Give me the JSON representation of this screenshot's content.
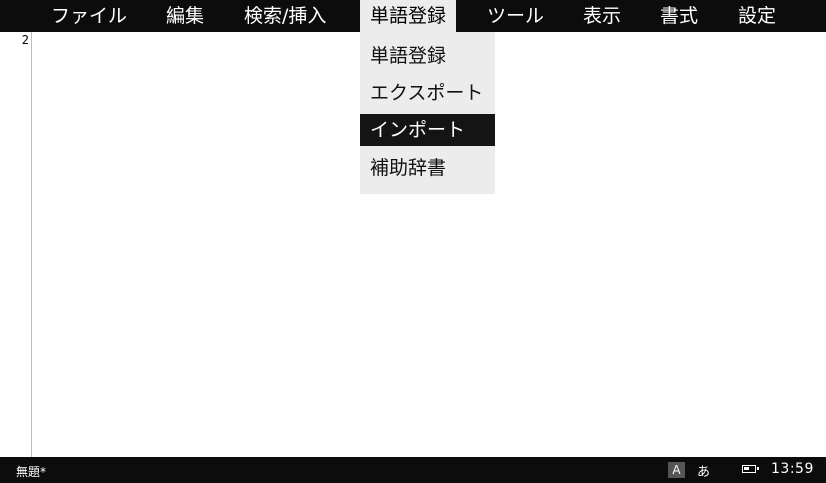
{
  "menubar": {
    "items": [
      {
        "label": "ファイル"
      },
      {
        "label": "編集"
      },
      {
        "label": "検索/挿入"
      },
      {
        "label": "単語登録",
        "active": true
      },
      {
        "label": "ツール"
      },
      {
        "label": "表示"
      },
      {
        "label": "書式"
      },
      {
        "label": "設定"
      }
    ]
  },
  "editor": {
    "line_number": "2"
  },
  "dropdown": {
    "items": [
      {
        "label": "単語登録"
      },
      {
        "label": "エクスポート"
      },
      {
        "label": "インポート",
        "selected": true
      },
      {
        "label": "補助辞書"
      }
    ]
  },
  "statusbar": {
    "document_title": "無題*",
    "ime_indicator": "A",
    "ime_mode": "あ",
    "battery_icon": "battery-icon",
    "time": "13:59"
  },
  "colors": {
    "bar_background": "#0c0c0c",
    "dropdown_background": "#ececec",
    "selected_background": "#141414"
  }
}
